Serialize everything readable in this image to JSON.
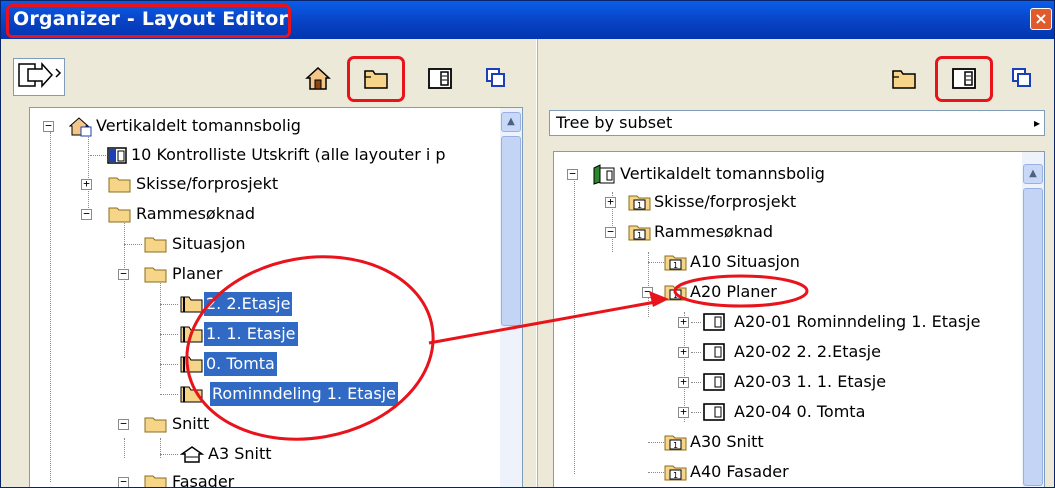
{
  "window": {
    "title": "Organizer - Layout Editor",
    "close_glyph": "×"
  },
  "left": {
    "toolbar": {
      "dropdown_icon": "send-arrow-icon",
      "buttons": [
        "home-icon",
        "folder-view-icon",
        "layout-icon",
        "clone-icon"
      ]
    },
    "tree": [
      {
        "label": "Vertikaldelt tomannsbolig",
        "icon": "house-project-icon"
      },
      {
        "label": "10 Kontrolliste Utskrift (alle layouter i p",
        "icon": "layout-icon"
      },
      {
        "label": "Skisse/forprosjekt",
        "icon": "folder-icon"
      },
      {
        "label": "Rammesøknad",
        "icon": "folder-icon"
      },
      {
        "label": "Situasjon",
        "icon": "folder-icon"
      },
      {
        "label": "Planer",
        "icon": "folder-icon"
      },
      {
        "label": "2. 2.Etasje",
        "icon": "floorplan-icon",
        "selected": true
      },
      {
        "label": "1. 1. Etasje",
        "icon": "floorplan-icon",
        "selected": true
      },
      {
        "label": "0.  Tomta",
        "icon": "floorplan-icon",
        "selected": true
      },
      {
        "label": "Rominndeling 1. Etasje",
        "icon": "floorplan-icon",
        "selected": true
      },
      {
        "label": "Snitt",
        "icon": "folder-icon"
      },
      {
        "label": "A3 Snitt",
        "icon": "section-icon"
      },
      {
        "label": "Fasader",
        "icon": "folder-icon"
      }
    ]
  },
  "right": {
    "toolbar": {
      "buttons": [
        "folder-view-icon",
        "layout-icon",
        "clone-icon"
      ]
    },
    "dropdown": {
      "value": "Tree by subset",
      "arrow": "▸"
    },
    "tree": [
      {
        "label": "Vertikaldelt tomannsbolig",
        "icon": "book-project-icon"
      },
      {
        "label": "Skisse/forprosjekt",
        "icon": "subset-folder-icon"
      },
      {
        "label": "Rammesøknad",
        "icon": "subset-folder-icon"
      },
      {
        "label": "A10 Situasjon",
        "icon": "subset-folder-icon"
      },
      {
        "label": "A20 Planer",
        "icon": "subset-folder-icon"
      },
      {
        "label": "A20-01 Rominndeling 1. Etasje",
        "icon": "layout-icon"
      },
      {
        "label": "A20-02 2. 2.Etasje",
        "icon": "layout-icon"
      },
      {
        "label": "A20-03 1. 1. Etasje",
        "icon": "layout-icon"
      },
      {
        "label": "A20-04 0.  Tomta",
        "icon": "layout-icon"
      },
      {
        "label": "A30 Snitt",
        "icon": "subset-folder-icon"
      },
      {
        "label": "A40 Fasader",
        "icon": "subset-folder-icon"
      }
    ]
  },
  "colors": {
    "selection": "#316ac5",
    "annotation": "#e8131b",
    "titlebar": "#0842c4"
  }
}
